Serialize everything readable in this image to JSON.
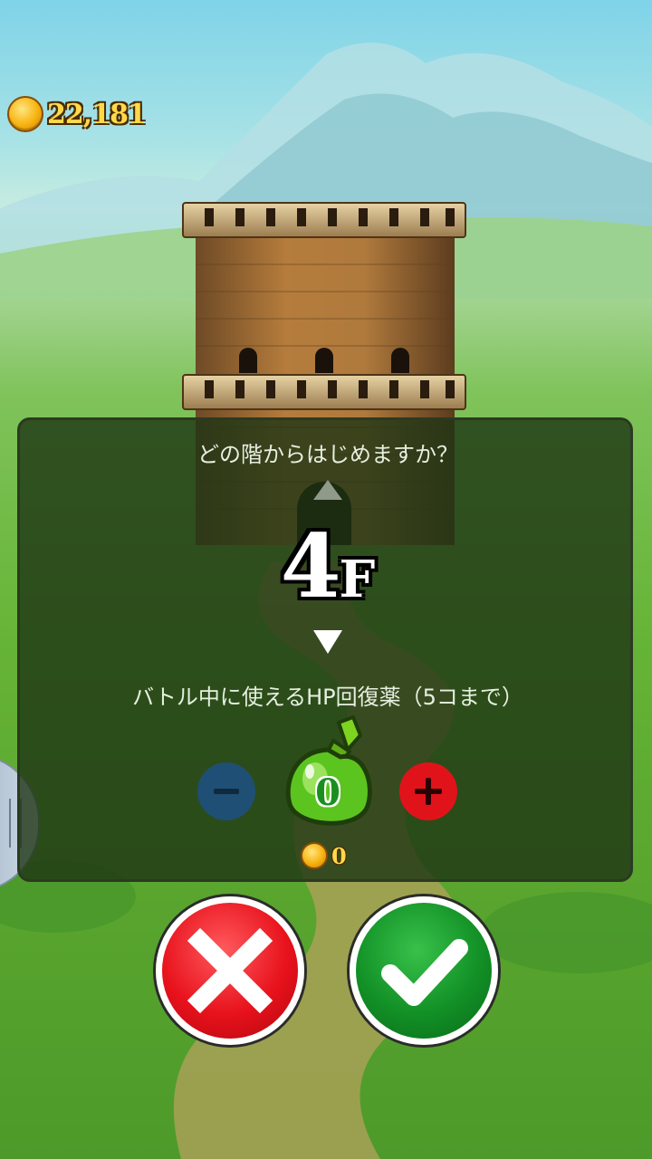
{
  "wallet": {
    "coins": "22,181",
    "icon": "coin-icon"
  },
  "dialog": {
    "question": "どの階からはじめますか？",
    "floor": {
      "number": "4",
      "unit": "F"
    },
    "potion_label": "バトル中に使えるHP回復薬（5コまで）",
    "potion_count": "0",
    "potion_cost": "0"
  },
  "colors": {
    "panel_bg": "#1e3414",
    "minus": "#1f4f74",
    "plus": "#e0131b",
    "cancel": "#e8121c",
    "confirm": "#129026",
    "coin": "#f7b20f"
  },
  "icons": {
    "up": "triangle-up-icon",
    "down": "triangle-down-icon",
    "minus": "minus-icon",
    "plus": "plus-icon",
    "potion": "green-potion-icon",
    "cancel": "x-icon",
    "confirm": "checkmark-icon"
  }
}
